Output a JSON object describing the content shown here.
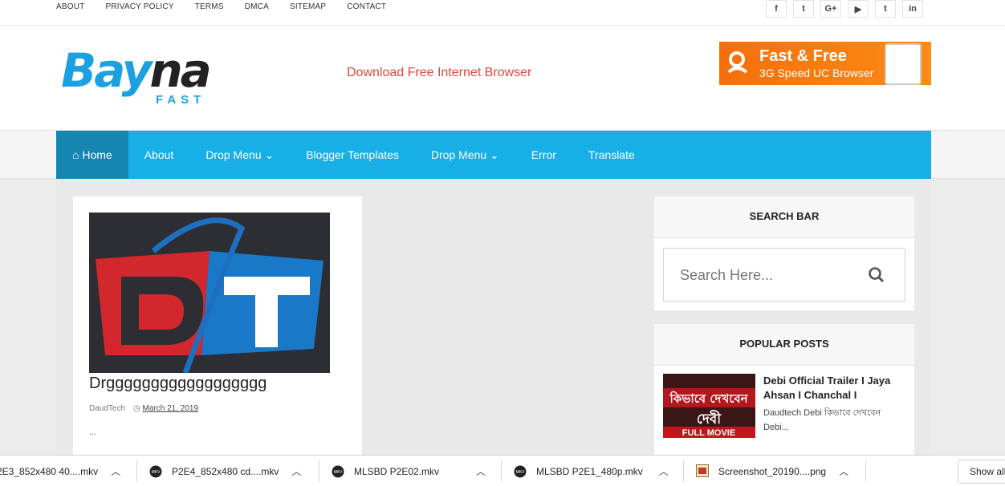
{
  "topnav": {
    "links": [
      "ABOUT",
      "PRIVACY POLICY",
      "TERMS",
      "DMCA",
      "SITEMAP",
      "CONTACT"
    ],
    "social": [
      {
        "icon": "facebook-icon",
        "glyph": "f"
      },
      {
        "icon": "twitter-icon",
        "glyph": "t"
      },
      {
        "icon": "google-plus-icon",
        "glyph": "G+"
      },
      {
        "icon": "youtube-icon",
        "glyph": "▶"
      },
      {
        "icon": "tumblr-icon",
        "glyph": "t"
      },
      {
        "icon": "linkedin-icon",
        "glyph": "in"
      }
    ]
  },
  "header": {
    "logo_main_a": "Bay",
    "logo_main_b": "na",
    "logo_sub": "FAST",
    "tagline": "Download Free Internet Browser",
    "ad_line1": "Fast & Free",
    "ad_line2": "3G Speed UC Browser"
  },
  "nav": {
    "items": [
      "Home",
      "About",
      "Drop Menu",
      "Blogger Templates",
      "Drop Menu",
      "Error",
      "Translate"
    ],
    "active": "Home"
  },
  "post": {
    "title": "Drgggggggggggggggggg",
    "author": "DaudTech",
    "date": "March 21, 2019",
    "excerpt": "..."
  },
  "sidebar": {
    "search_title": "SEARCH BAR",
    "search_placeholder": "Search Here...",
    "popular_title": "POPULAR POSTS",
    "popular": {
      "title": "Debi Official Trailer I Jaya Ahsan I Chanchal I",
      "snippet": "Daudtech Debi কিভাবে দেখবেন Debi...",
      "thumb_text_top": "কিভাবে দেখবেন",
      "thumb_text_mid": "দেবী",
      "thumb_text_bottom": "FULL MOVIE"
    }
  },
  "downloads": {
    "files": [
      "2E3_852x480 40....mkv",
      "P2E4_852x480 cd....mkv",
      "MLSBD P2E02.mkv",
      "MLSBD P2E1_480p.mkv",
      "Screenshot_20190....png"
    ],
    "show_all": "Show all"
  },
  "colors": {
    "accent": "#18aee6",
    "accent_dark": "#1585b1",
    "tagline": "#e0473c"
  }
}
